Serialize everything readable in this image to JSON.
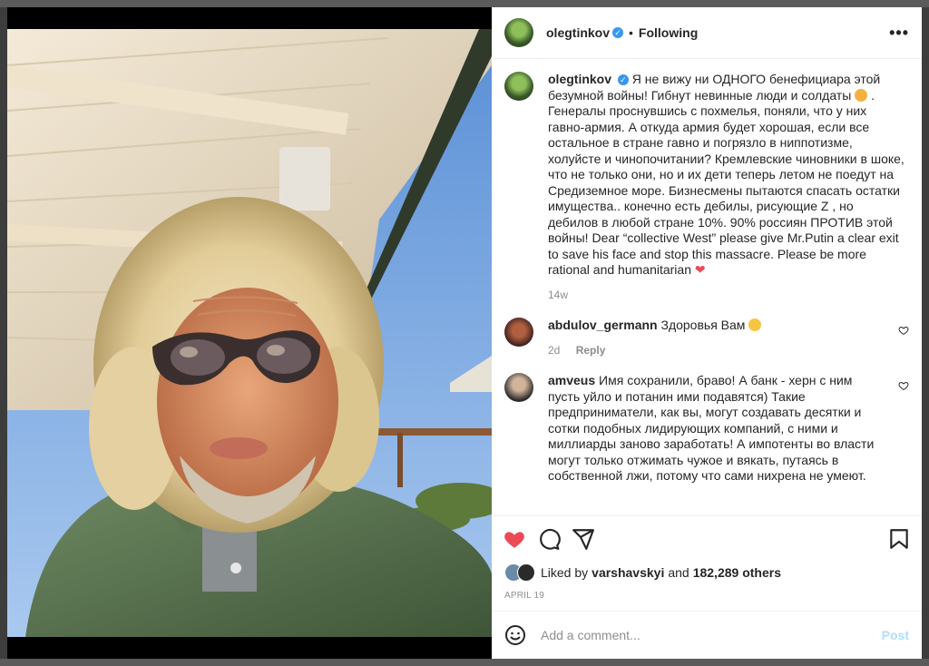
{
  "post": {
    "username": "olegtinkov",
    "separator": "•",
    "following_label": "Following",
    "more_label": "•••"
  },
  "caption": {
    "username": "olegtinkov",
    "text": "Я не вижу ни ОДНОГО бенефициара этой безумной войны! Гибнут невинные люди и солдаты",
    "text2": ". Генералы проснувшись с похмелья, поняли, что у них гавно-армия. А откуда армия будет хорошая, если все остальное в стране гавно и погрязло в ниппотизме, холуйсте и чинопочитании? Кремлевские чиновники в шоке, что не только они, но и их дети теперь летом не поедут на Средиземное море. Бизнесмены пытаются спасать остатки имущества.. конечно есть дебилы, рисующие Z , но дебилов в любой стране 10%. 90% россиян ПРОТИВ этой войны! Dear “collective West” please give Mr.Putin a clear exit to save his face and stop this massacre. Please be more rational and humanitarian",
    "time": "14w"
  },
  "comments": [
    {
      "username": "abdulov_germann",
      "text": "Здоровья Вам",
      "time": "2d",
      "reply_label": "Reply"
    },
    {
      "username": "amveus",
      "text": "Имя сохранили, браво! А банк - херн с ним пусть уйло и потанин ими подавятся) Такие предприниматели, как вы, могут создавать десятки и сотки подобных лидирующих компаний, с ними и миллиарды заново заработать! А импотенты во власти могут только отжимать чужое и вякать, путаясь в собственной лжи, потому что сами нихрена не умеют."
    }
  ],
  "likes": {
    "prefix": "Liked by",
    "liker": "varshavskyi",
    "conjunction": "and",
    "count": "182,289 others"
  },
  "date": "APRIL 19",
  "add_comment": {
    "placeholder": "Add a comment...",
    "post_label": "Post"
  },
  "colors": {
    "like_red": "#ed4956",
    "verified_blue": "#3897f0",
    "post_button": "#b2dffc"
  },
  "icons": [
    "heart-icon",
    "comment-icon",
    "share-icon",
    "bookmark-icon",
    "emoji-icon",
    "verified-icon",
    "more-icon"
  ]
}
